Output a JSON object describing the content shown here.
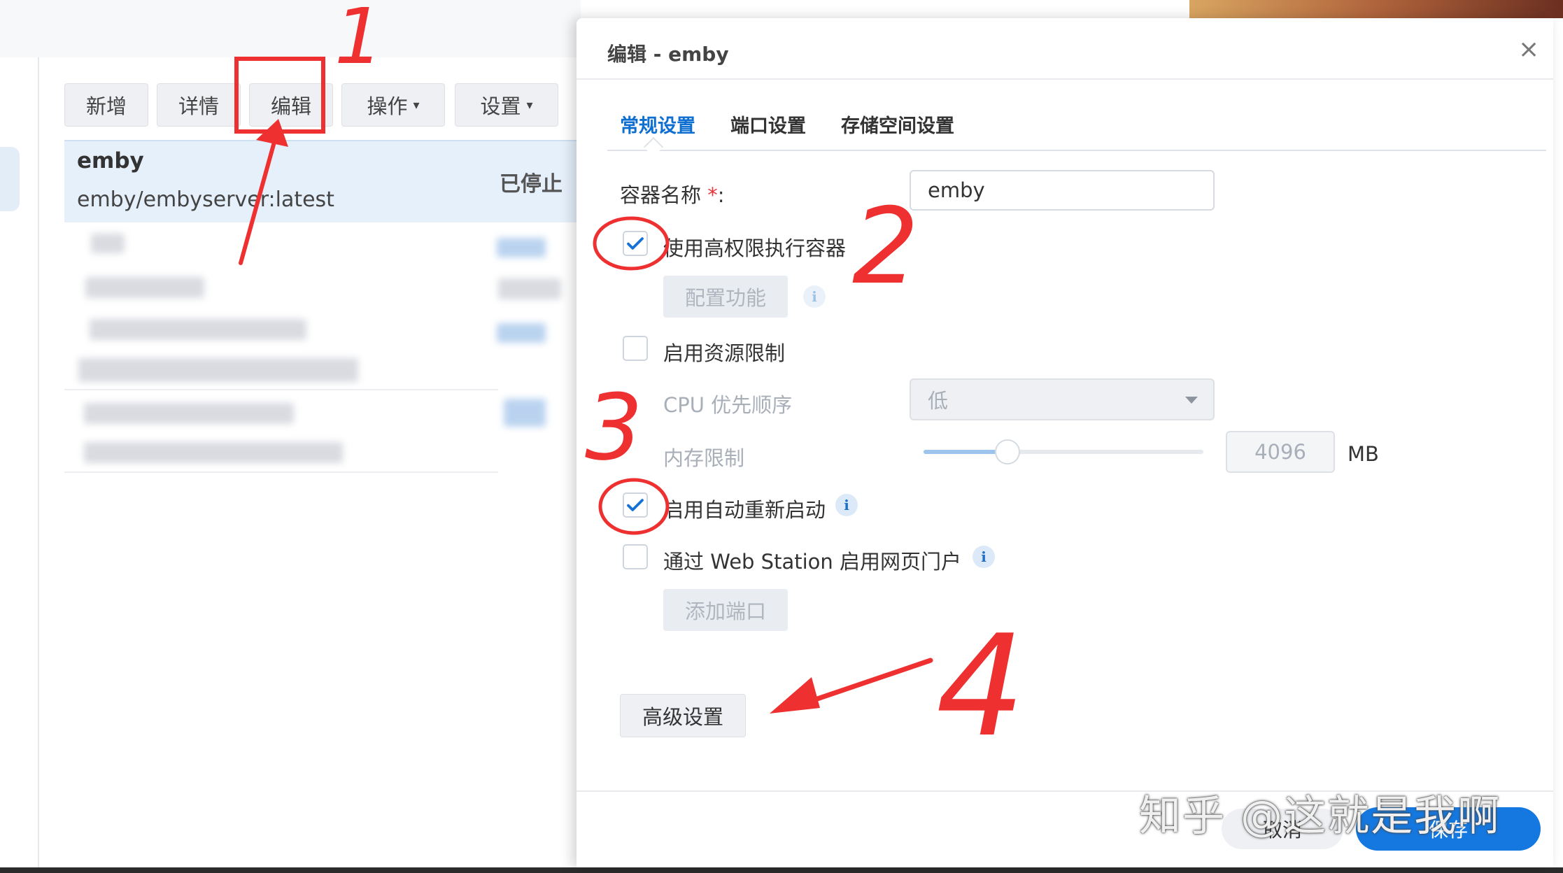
{
  "toolbar": {
    "add": "新增",
    "detail": "详情",
    "edit": "编辑",
    "action": "操作",
    "settings": "设置"
  },
  "container_list": {
    "selected": {
      "name": "emby",
      "image": "emby/embyserver:latest",
      "status": "已停止"
    }
  },
  "dialog": {
    "title": "编辑 - emby",
    "close": "×",
    "tabs": [
      "常规设置",
      "端口设置",
      "存储空间设置"
    ],
    "container_name_label": "容器名称",
    "required_mark": "*",
    "colon": ":",
    "container_name_value": "emby",
    "privileged_label": "使用高权限执行容器",
    "privileged_checked": true,
    "config_function": "配置功能",
    "resource_limit_label": "启用资源限制",
    "resource_limit_checked": false,
    "cpu_priority_label": "CPU 优先顺序",
    "cpu_priority_value": "低",
    "memory_limit_label": "内存限制",
    "memory_value": "4096",
    "memory_unit": "MB",
    "memory_slider_fraction": 0.3,
    "auto_restart_label": "启用自动重新启动",
    "auto_restart_checked": true,
    "web_station_label": "通过 Web Station 启用网页门户",
    "web_station_checked": false,
    "add_port": "添加端口",
    "advanced": "高级设置",
    "cancel": "取消",
    "save": "保存"
  },
  "annotations": {
    "num1": "1",
    "num2": "2",
    "num3": "3",
    "num4": "4"
  },
  "watermark": "知乎 @这就是我啊",
  "colors": {
    "accent": "#1478e0",
    "annotation": "#ee3030",
    "selected_row": "#e6f0fb"
  }
}
